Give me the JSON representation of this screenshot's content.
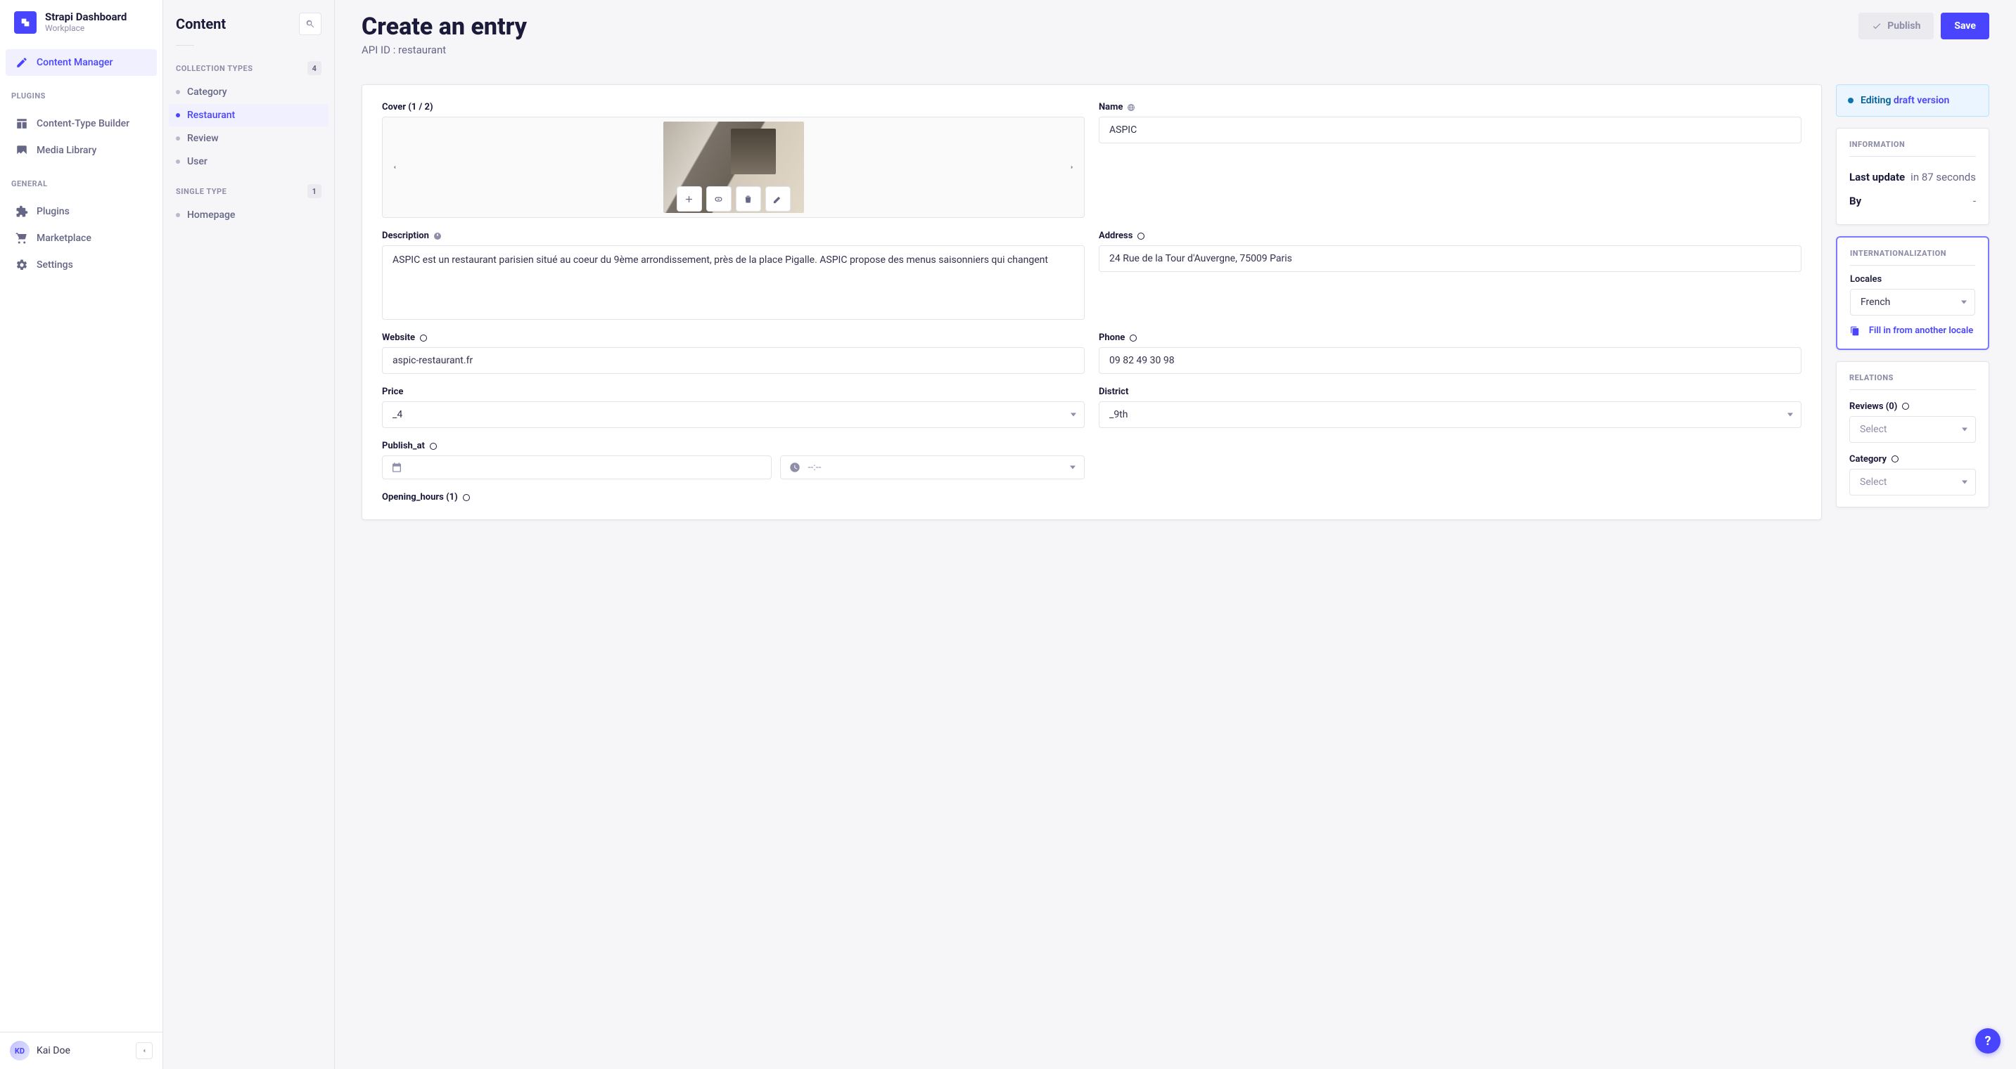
{
  "brand": {
    "title": "Strapi Dashboard",
    "subtitle": "Workplace"
  },
  "nav": {
    "content_manager": "Content Manager",
    "plugins_heading": "PLUGINS",
    "content_type_builder": "Content-Type Builder",
    "media_library": "Media Library",
    "general_heading": "GENERAL",
    "plugins": "Plugins",
    "marketplace": "Marketplace",
    "settings": "Settings"
  },
  "user": {
    "initials": "KD",
    "name": "Kai Doe"
  },
  "subnav": {
    "title": "Content",
    "collection_heading": "COLLECTION TYPES",
    "collection_count": "4",
    "collection_items": [
      "Category",
      "Restaurant",
      "Review",
      "User"
    ],
    "single_heading": "SINGLE TYPE",
    "single_count": "1",
    "single_items": [
      "Homepage"
    ]
  },
  "page": {
    "title": "Create an entry",
    "api_id": "API ID : restaurant",
    "publish": "Publish",
    "save": "Save"
  },
  "form": {
    "cover_label": "Cover (1 / 2)",
    "name_label": "Name",
    "name_value": "ASPIC",
    "description_label": "Description",
    "description_value": "ASPIC est un restaurant parisien situé au coeur du 9ème arrondissement, près de la place Pigalle. ASPIC propose des menus saisonniers qui changent",
    "address_label": "Address",
    "address_value": "24 Rue de la Tour d'Auvergne, 75009 Paris",
    "website_label": "Website",
    "website_value": "aspic-restaurant.fr",
    "phone_label": "Phone",
    "phone_value": "09 82 49 30 98",
    "price_label": "Price",
    "price_value": "_4",
    "district_label": "District",
    "district_value": "_9th",
    "publish_at_label": "Publish_at",
    "time_placeholder": "--:--",
    "opening_hours_label": "Opening_hours (1)"
  },
  "side": {
    "status_text": "Editing ",
    "status_link": "draft version",
    "info_heading": "INFORMATION",
    "last_update_k": "Last update",
    "last_update_v": "in 87 seconds",
    "by_k": "By",
    "by_v": "-",
    "intl_heading": "INTERNATIONALIZATION",
    "locales_label": "Locales",
    "locale_value": "French",
    "fill_link": "Fill in from another locale",
    "relations_heading": "RELATIONS",
    "reviews_label": "Reviews (0)",
    "category_label": "Category",
    "select_placeholder": "Select"
  }
}
